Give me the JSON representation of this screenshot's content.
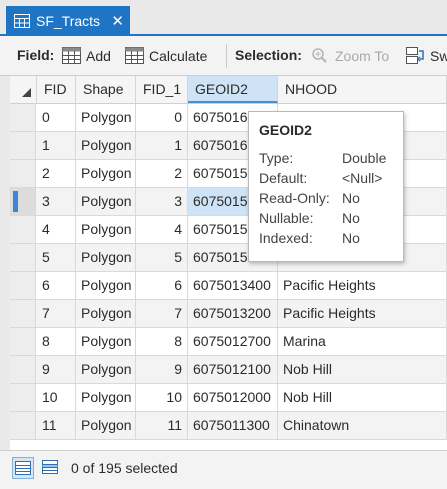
{
  "tab": {
    "title": "SF_Tracts",
    "close_glyph": "✕",
    "icon": "table-icon"
  },
  "toolbar": {
    "field_label": "Field:",
    "add_label": "Add",
    "calculate_label": "Calculate",
    "selection_label": "Selection:",
    "zoom_to_label": "Zoom To",
    "switch_label": "Sw"
  },
  "columns": [
    "FID",
    "Shape",
    "FID_1",
    "GEOID2",
    "NHOOD"
  ],
  "rows": [
    {
      "fid": "0",
      "shape": "Polygon",
      "fid1": "0",
      "geoid": "6075016",
      "nhood": ""
    },
    {
      "fid": "1",
      "shape": "Polygon",
      "fid1": "1",
      "geoid": "6075016",
      "nhood": ""
    },
    {
      "fid": "2",
      "shape": "Polygon",
      "fid1": "2",
      "geoid": "6075015",
      "nhood": ""
    },
    {
      "fid": "3",
      "shape": "Polygon",
      "fid1": "3",
      "geoid": "6075015",
      "nhood": ""
    },
    {
      "fid": "4",
      "shape": "Polygon",
      "fid1": "4",
      "geoid": "6075015",
      "nhood": ""
    },
    {
      "fid": "5",
      "shape": "Polygon",
      "fid1": "5",
      "geoid": "6075015",
      "nhood": ""
    },
    {
      "fid": "6",
      "shape": "Polygon",
      "fid1": "6",
      "geoid": "6075013400",
      "nhood": "Pacific Heights"
    },
    {
      "fid": "7",
      "shape": "Polygon",
      "fid1": "7",
      "geoid": "6075013200",
      "nhood": "Pacific Heights"
    },
    {
      "fid": "8",
      "shape": "Polygon",
      "fid1": "8",
      "geoid": "6075012700",
      "nhood": "Marina"
    },
    {
      "fid": "9",
      "shape": "Polygon",
      "fid1": "9",
      "geoid": "6075012100",
      "nhood": "Nob Hill"
    },
    {
      "fid": "10",
      "shape": "Polygon",
      "fid1": "10",
      "geoid": "6075012000",
      "nhood": "Nob Hill"
    },
    {
      "fid": "11",
      "shape": "Polygon",
      "fid1": "11",
      "geoid": "6075011300",
      "nhood": "Chinatown"
    }
  ],
  "active_row_index": 3,
  "tooltip": {
    "title": "GEOID2",
    "props": [
      {
        "key": "Type:",
        "value": "Double"
      },
      {
        "key": "Default:",
        "value": "<Null>"
      },
      {
        "key": "Read-Only:",
        "value": "No"
      },
      {
        "key": "Nullable:",
        "value": "No"
      },
      {
        "key": "Indexed:",
        "value": "No"
      }
    ]
  },
  "status": {
    "selected_text": "0 of 195 selected"
  },
  "colors": {
    "accent": "#1f74c4",
    "selected_header": "#cfe3f7"
  }
}
